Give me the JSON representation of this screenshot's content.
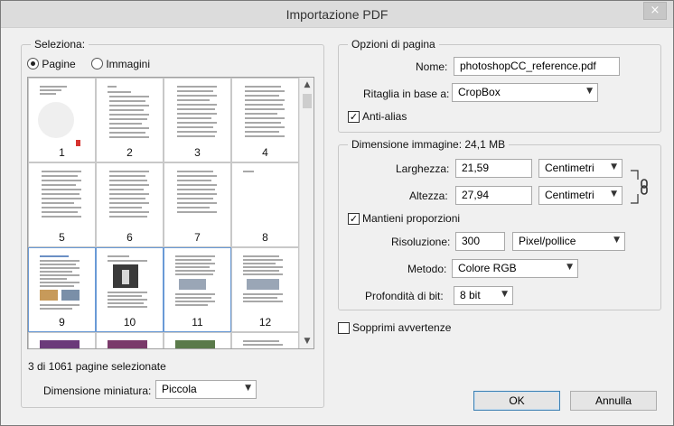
{
  "window": {
    "title": "Importazione PDF",
    "close_glyph": "×"
  },
  "select_group": {
    "legend": "Seleziona:",
    "radio_pages": "Pagine",
    "radio_images": "Immagini",
    "status": "3 di 1061 pagine selezionate",
    "thumb_size_label": "Dimensione miniatura:",
    "thumb_size_value": "Piccola"
  },
  "thumbnails": [
    {
      "num": "1"
    },
    {
      "num": "2"
    },
    {
      "num": "3"
    },
    {
      "num": "4"
    },
    {
      "num": "5"
    },
    {
      "num": "6"
    },
    {
      "num": "7"
    },
    {
      "num": "8"
    },
    {
      "num": "9"
    },
    {
      "num": "10"
    },
    {
      "num": "11"
    },
    {
      "num": "12"
    }
  ],
  "page_options": {
    "legend": "Opzioni di pagina",
    "name_label": "Nome:",
    "name_value": "photoshopCC_reference.pdf",
    "crop_label": "Ritaglia in base a:",
    "crop_value": "CropBox",
    "antialias_label": "Anti-alias",
    "antialias_checked": "✓"
  },
  "image_size": {
    "legend": "Dimensione immagine: 24,1 MB",
    "width_label": "Larghezza:",
    "width_value": "21,59",
    "width_unit": "Centimetri",
    "height_label": "Altezza:",
    "height_value": "27,94",
    "height_unit": "Centimetri",
    "keep_prop_label": "Mantieni proporzioni",
    "keep_prop_checked": "✓",
    "resolution_label": "Risoluzione:",
    "resolution_value": "300",
    "resolution_unit": "Pixel/pollice",
    "mode_label": "Metodo:",
    "mode_value": "Colore RGB",
    "depth_label": "Profondità di bit:",
    "depth_value": "8 bit"
  },
  "suppress_warnings_label": "Sopprimi avvertenze",
  "buttons": {
    "ok": "OK",
    "cancel": "Annulla"
  },
  "colors": {
    "selection_border": "#6a9ad6",
    "default_button": "#3c7fb1"
  }
}
